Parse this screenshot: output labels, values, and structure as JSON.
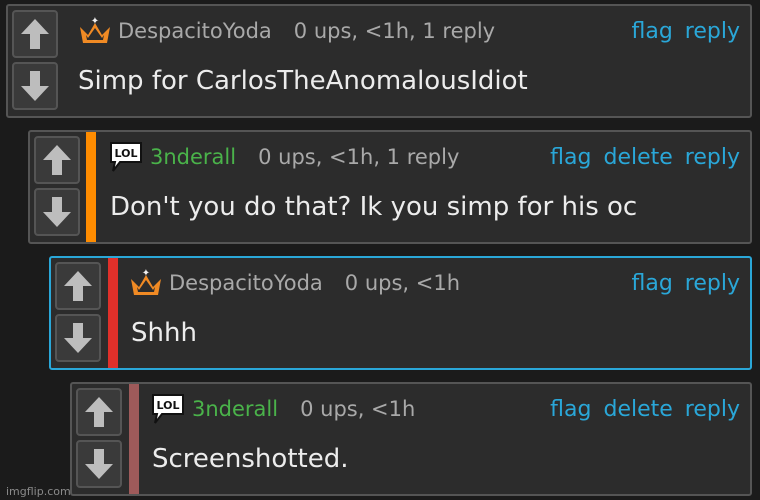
{
  "comments": [
    {
      "user": "DespacitoYoda",
      "badge": "crown-icon",
      "meta": "0 ups, <1h, 1 reply",
      "actions": [
        "flag",
        "reply"
      ],
      "text": "Simp for CarlosTheAnomalousIdiot",
      "bar_color": null,
      "user_color": "#a9a9a9"
    },
    {
      "user": "3nderall",
      "badge": "lol-bubble-icon",
      "badge_text": "LOL",
      "meta": "0 ups, <1h, 1 reply",
      "actions": [
        "flag",
        "delete",
        "reply"
      ],
      "text": "Don't you do that? Ik you simp for his oc",
      "bar_color": "#ff8c00",
      "user_color": "#4ab34a"
    },
    {
      "user": "DespacitoYoda",
      "badge": "crown-icon",
      "meta": "0 ups, <1h",
      "actions": [
        "flag",
        "reply"
      ],
      "text": "Shhh",
      "bar_color": "#e0302a",
      "user_color": "#a9a9a9",
      "highlighted": true
    },
    {
      "user": "3nderall",
      "badge": "lol-bubble-icon",
      "badge_text": "LOL",
      "meta": "0 ups, <1h",
      "actions": [
        "flag",
        "delete",
        "reply"
      ],
      "text": "Screenshotted.",
      "bar_color": "#9e5a5a",
      "user_color": "#4ab34a"
    }
  ],
  "watermark": "imgflip.com",
  "colors": {
    "link": "#2aa7d8",
    "background": "#1b1b1b",
    "card": "#2c2c2c"
  }
}
